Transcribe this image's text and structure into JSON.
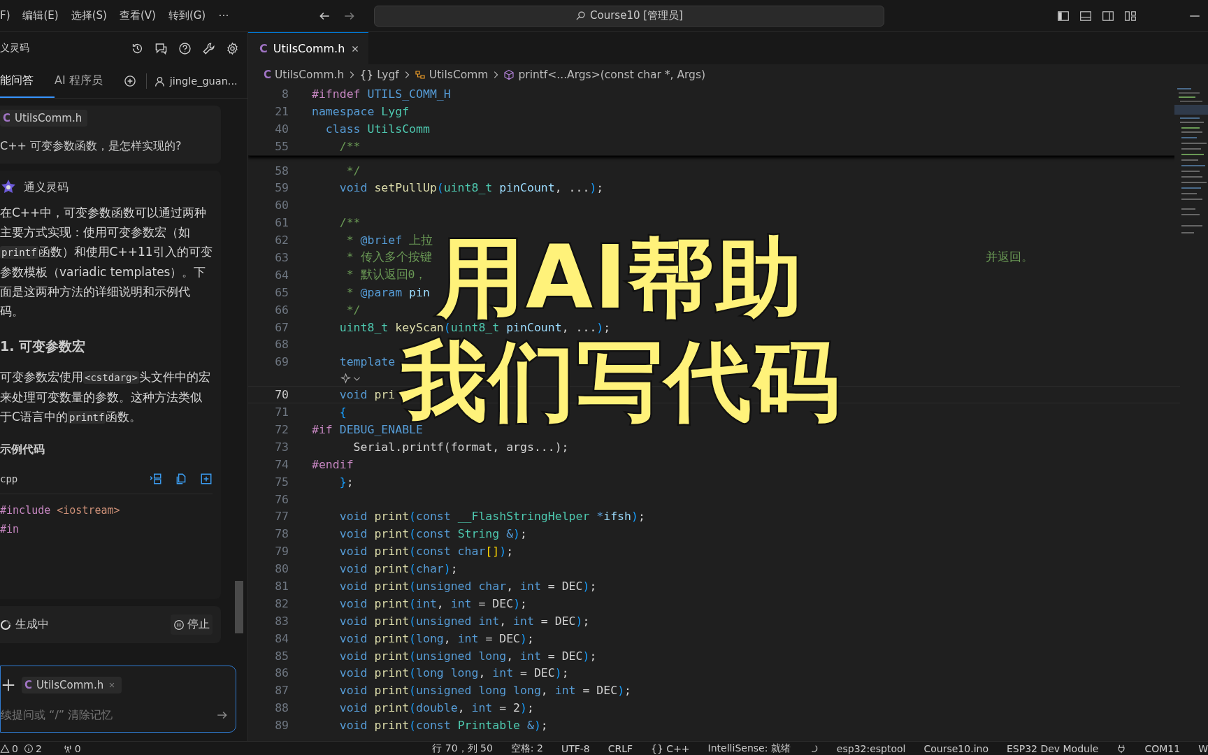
{
  "menu": [
    "F)",
    "编辑(E)",
    "选择(S)",
    "查看(V)",
    "转到(G)",
    "⋯"
  ],
  "command_center": "Course10 [管理员]",
  "assistant": {
    "title": "义灵码",
    "tabs": [
      {
        "label": "能问答",
        "selected": true
      },
      {
        "label": "AI 程序员",
        "selected": false
      }
    ],
    "user": "jingle_guan...",
    "context_file": {
      "glyph": "C",
      "name": "UtilsComm.h"
    },
    "question": "C++ 可变参数函数，是怎样实现的?",
    "answer_author": "通义灵码",
    "answer": [
      {
        "kind": "paragraph",
        "segments": [
          {
            "kind": "text",
            "text": "在C++中，可变参数函数可以通过两种主要方式实现：使用可变参数宏（如"
          },
          {
            "kind": "code",
            "text": "printf"
          },
          {
            "kind": "text",
            "text": "函数）和使用C++11引入的可变参数模板（variadic templates）。下面是这两种方法的详细说明和示例代码。"
          }
        ]
      },
      {
        "kind": "heading",
        "text": "1. 可变参数宏"
      },
      {
        "kind": "paragraph",
        "segments": [
          {
            "kind": "text",
            "text": "可变参数宏使用"
          },
          {
            "kind": "code",
            "text": "<cstdarg>"
          },
          {
            "kind": "text",
            "text": "头文件中的宏来处理可变数量的参数。这种方法类似于C语言中的"
          },
          {
            "kind": "code",
            "text": "printf"
          },
          {
            "kind": "text",
            "text": "函数。"
          }
        ]
      },
      {
        "kind": "subheading",
        "text": "示例代码"
      },
      {
        "kind": "codeblock",
        "lang": "cpp",
        "lines": [
          [
            {
              "text": "#include ",
              "kind": "macro"
            },
            {
              "text": "<iostream>",
              "kind": "str"
            }
          ],
          [
            {
              "text": "#in",
              "kind": "macro"
            }
          ]
        ]
      }
    ],
    "status": "生成中",
    "stop": "停止",
    "input": {
      "chip": {
        "glyph": "C",
        "name": "UtilsComm.h"
      },
      "placeholder": "续提问或 “/” 清除记忆"
    }
  },
  "editor": {
    "tabs": [
      {
        "glyph": "C",
        "label": "UtilsComm.h",
        "selected": true
      }
    ],
    "breadcrumb": [
      {
        "kind": "file",
        "glyph": "C",
        "label": "UtilsComm.h"
      },
      {
        "kind": "namespace",
        "glyph": "{}",
        "label": "Lygf"
      },
      {
        "kind": "class",
        "label": "UtilsComm"
      },
      {
        "kind": "method",
        "label": "printf<...Args>(const char *, Args)"
      }
    ],
    "sticky_lines": [
      {
        "n": "8",
        "tokens": [
          {
            "text": "#ifndef ",
            "kind": "macro"
          },
          {
            "text": "UTILS_COMM_H",
            "kind": "kw"
          }
        ]
      },
      {
        "n": "21",
        "tokens": [
          {
            "text": "namespace ",
            "kind": "kw"
          },
          {
            "text": "Lygf",
            "kind": "type"
          }
        ]
      },
      {
        "n": "40",
        "tokens": [
          {
            "text": "  class ",
            "kind": "kw"
          },
          {
            "text": "UtilsComm",
            "kind": "type"
          }
        ]
      },
      {
        "n": "55",
        "tokens": [
          {
            "text": "    /**",
            "kind": "cm"
          }
        ]
      }
    ],
    "lines": [
      {
        "kind": "code",
        "n": "58",
        "current": false,
        "tokens": [
          {
            "text": "     */",
            "kind": "cm"
          }
        ]
      },
      {
        "kind": "code",
        "n": "59",
        "current": false,
        "tokens": [
          {
            "text": "    void ",
            "kind": "kw"
          },
          {
            "text": "setPullUp",
            "kind": "fn"
          },
          {
            "text": "(",
            "kind": "br"
          },
          {
            "text": "uint8_t ",
            "kind": "type"
          },
          {
            "text": "pinCount",
            "kind": "var"
          },
          {
            "text": ", ...",
            "kind": "p"
          },
          {
            "text": ")",
            "kind": "br"
          },
          {
            "text": ";",
            "kind": "p"
          }
        ]
      },
      {
        "kind": "code",
        "n": "60",
        "current": false
      },
      {
        "kind": "code",
        "n": "61",
        "current": false,
        "tokens": [
          {
            "text": "    /**",
            "kind": "cm"
          }
        ]
      },
      {
        "kind": "code",
        "n": "62",
        "current": false,
        "tokens": [
          {
            "text": "     * ",
            "kind": "cm"
          },
          {
            "text": "@brief",
            "kind": "doc"
          },
          {
            "text": " 上拉",
            "kind": "cm"
          }
        ]
      },
      {
        "kind": "code",
        "n": "63",
        "current": false,
        "tokens": [
          {
            "text": "     * 传入多个按键",
            "kind": "cm"
          }
        ],
        "tail": [
          {
            "text": "并返回。",
            "kind": "cm"
          }
        ]
      },
      {
        "kind": "code",
        "n": "64",
        "current": false,
        "tokens": [
          {
            "text": "     * 默认返回0，",
            "kind": "cm"
          }
        ]
      },
      {
        "kind": "code",
        "n": "65",
        "current": false,
        "tokens": [
          {
            "text": "     * ",
            "kind": "cm"
          },
          {
            "text": "@param",
            "kind": "doc"
          },
          {
            "text": " pin",
            "kind": "var"
          }
        ]
      },
      {
        "kind": "code",
        "n": "66",
        "current": false,
        "tokens": [
          {
            "text": "     */",
            "kind": "cm"
          }
        ]
      },
      {
        "kind": "code",
        "n": "67",
        "current": false,
        "tokens": [
          {
            "text": "    uint8_t ",
            "kind": "type"
          },
          {
            "text": "keyScan",
            "kind": "fn"
          },
          {
            "text": "(",
            "kind": "br"
          },
          {
            "text": "uint8_t ",
            "kind": "type"
          },
          {
            "text": "pinCount",
            "kind": "var"
          },
          {
            "text": ", ...",
            "kind": "p"
          },
          {
            "text": ")",
            "kind": "br"
          },
          {
            "text": ";",
            "kind": "p"
          }
        ]
      },
      {
        "kind": "code",
        "n": "68",
        "current": false
      },
      {
        "kind": "code",
        "n": "69",
        "current": false,
        "tokens": [
          {
            "text": "    template",
            "kind": "kw"
          }
        ]
      },
      {
        "kind": "codelens"
      },
      {
        "kind": "code",
        "n": "70",
        "current": true,
        "tokens": [
          {
            "text": "    void ",
            "kind": "kw"
          },
          {
            "text": "pri",
            "kind": "fn"
          }
        ]
      },
      {
        "kind": "code",
        "n": "71",
        "current": false,
        "tokens": [
          {
            "text": "    {",
            "kind": "br"
          }
        ]
      },
      {
        "kind": "code",
        "n": "72",
        "current": false,
        "tokens": [
          {
            "text": "#if ",
            "kind": "macro"
          },
          {
            "text": "DEBUG_ENABLE",
            "kind": "kw"
          }
        ]
      },
      {
        "kind": "code",
        "n": "73",
        "current": false,
        "tokens": [
          {
            "text": "      Serial.printf(format, args...);",
            "kind": "p"
          }
        ]
      },
      {
        "kind": "code",
        "n": "74",
        "current": false,
        "tokens": [
          {
            "text": "#endif",
            "kind": "macro"
          }
        ]
      },
      {
        "kind": "code",
        "n": "75",
        "current": false,
        "tokens": [
          {
            "text": "    }",
            "kind": "br"
          },
          {
            "text": ";",
            "kind": "p"
          }
        ]
      },
      {
        "kind": "code",
        "n": "76",
        "current": false
      },
      {
        "kind": "code",
        "n": "77",
        "current": false,
        "tokens": [
          {
            "text": "    void ",
            "kind": "kw"
          },
          {
            "text": "print",
            "kind": "fn"
          },
          {
            "text": "(",
            "kind": "br"
          },
          {
            "text": "const ",
            "kind": "kw"
          },
          {
            "text": "__FlashStringHelper ",
            "kind": "type"
          },
          {
            "text": "*",
            "kind": "kw"
          },
          {
            "text": "ifsh",
            "kind": "var"
          },
          {
            "text": ")",
            "kind": "br"
          },
          {
            "text": ";",
            "kind": "p"
          }
        ]
      },
      {
        "kind": "code",
        "n": "78",
        "current": false,
        "tokens": [
          {
            "text": "    void ",
            "kind": "kw"
          },
          {
            "text": "print",
            "kind": "fn"
          },
          {
            "text": "(",
            "kind": "br"
          },
          {
            "text": "const ",
            "kind": "kw"
          },
          {
            "text": "String ",
            "kind": "type"
          },
          {
            "text": "&",
            "kind": "kw"
          },
          {
            "text": ")",
            "kind": "br"
          },
          {
            "text": ";",
            "kind": "p"
          }
        ]
      },
      {
        "kind": "code",
        "n": "79",
        "current": false,
        "tokens": [
          {
            "text": "    void ",
            "kind": "kw"
          },
          {
            "text": "print",
            "kind": "fn"
          },
          {
            "text": "(",
            "kind": "br"
          },
          {
            "text": "const char",
            "kind": "kw"
          },
          {
            "text": "[]",
            "kind": "y"
          },
          {
            "text": ")",
            "kind": "br"
          },
          {
            "text": ";",
            "kind": "p"
          }
        ]
      },
      {
        "kind": "code",
        "n": "80",
        "current": false,
        "tokens": [
          {
            "text": "    void ",
            "kind": "kw"
          },
          {
            "text": "print",
            "kind": "fn"
          },
          {
            "text": "(",
            "kind": "br"
          },
          {
            "text": "char",
            "kind": "kw"
          },
          {
            "text": ")",
            "kind": "br"
          },
          {
            "text": ";",
            "kind": "p"
          }
        ]
      },
      {
        "kind": "code",
        "n": "81",
        "current": false,
        "tokens": [
          {
            "text": "    void ",
            "kind": "kw"
          },
          {
            "text": "print",
            "kind": "fn"
          },
          {
            "text": "(",
            "kind": "br"
          },
          {
            "text": "unsigned char",
            "kind": "kw"
          },
          {
            "text": ", ",
            "kind": "p"
          },
          {
            "text": "int",
            "kind": "kw"
          },
          {
            "text": " = DEC",
            "kind": "p"
          },
          {
            "text": ")",
            "kind": "br"
          },
          {
            "text": ";",
            "kind": "p"
          }
        ]
      },
      {
        "kind": "code",
        "n": "82",
        "current": false,
        "tokens": [
          {
            "text": "    void ",
            "kind": "kw"
          },
          {
            "text": "print",
            "kind": "fn"
          },
          {
            "text": "(",
            "kind": "br"
          },
          {
            "text": "int",
            "kind": "kw"
          },
          {
            "text": ", ",
            "kind": "p"
          },
          {
            "text": "int",
            "kind": "kw"
          },
          {
            "text": " = DEC",
            "kind": "p"
          },
          {
            "text": ")",
            "kind": "br"
          },
          {
            "text": ";",
            "kind": "p"
          }
        ]
      },
      {
        "kind": "code",
        "n": "83",
        "current": false,
        "tokens": [
          {
            "text": "    void ",
            "kind": "kw"
          },
          {
            "text": "print",
            "kind": "fn"
          },
          {
            "text": "(",
            "kind": "br"
          },
          {
            "text": "unsigned int",
            "kind": "kw"
          },
          {
            "text": ", ",
            "kind": "p"
          },
          {
            "text": "int",
            "kind": "kw"
          },
          {
            "text": " = DEC",
            "kind": "p"
          },
          {
            "text": ")",
            "kind": "br"
          },
          {
            "text": ";",
            "kind": "p"
          }
        ]
      },
      {
        "kind": "code",
        "n": "84",
        "current": false,
        "tokens": [
          {
            "text": "    void ",
            "kind": "kw"
          },
          {
            "text": "print",
            "kind": "fn"
          },
          {
            "text": "(",
            "kind": "br"
          },
          {
            "text": "long",
            "kind": "kw"
          },
          {
            "text": ", ",
            "kind": "p"
          },
          {
            "text": "int",
            "kind": "kw"
          },
          {
            "text": " = DEC",
            "kind": "p"
          },
          {
            "text": ")",
            "kind": "br"
          },
          {
            "text": ";",
            "kind": "p"
          }
        ]
      },
      {
        "kind": "code",
        "n": "85",
        "current": false,
        "tokens": [
          {
            "text": "    void ",
            "kind": "kw"
          },
          {
            "text": "print",
            "kind": "fn"
          },
          {
            "text": "(",
            "kind": "br"
          },
          {
            "text": "unsigned long",
            "kind": "kw"
          },
          {
            "text": ", ",
            "kind": "p"
          },
          {
            "text": "int",
            "kind": "kw"
          },
          {
            "text": " = DEC",
            "kind": "p"
          },
          {
            "text": ")",
            "kind": "br"
          },
          {
            "text": ";",
            "kind": "p"
          }
        ]
      },
      {
        "kind": "code",
        "n": "86",
        "current": false,
        "tokens": [
          {
            "text": "    void ",
            "kind": "kw"
          },
          {
            "text": "print",
            "kind": "fn"
          },
          {
            "text": "(",
            "kind": "br"
          },
          {
            "text": "long long",
            "kind": "kw"
          },
          {
            "text": ", ",
            "kind": "p"
          },
          {
            "text": "int",
            "kind": "kw"
          },
          {
            "text": " = DEC",
            "kind": "p"
          },
          {
            "text": ")",
            "kind": "br"
          },
          {
            "text": ";",
            "kind": "p"
          }
        ]
      },
      {
        "kind": "code",
        "n": "87",
        "current": false,
        "tokens": [
          {
            "text": "    void ",
            "kind": "kw"
          },
          {
            "text": "print",
            "kind": "fn"
          },
          {
            "text": "(",
            "kind": "br"
          },
          {
            "text": "unsigned long long",
            "kind": "kw"
          },
          {
            "text": ", ",
            "kind": "p"
          },
          {
            "text": "int",
            "kind": "kw"
          },
          {
            "text": " = DEC",
            "kind": "p"
          },
          {
            "text": ")",
            "kind": "br"
          },
          {
            "text": ";",
            "kind": "p"
          }
        ]
      },
      {
        "kind": "code",
        "n": "88",
        "current": false,
        "tokens": [
          {
            "text": "    void ",
            "kind": "kw"
          },
          {
            "text": "print",
            "kind": "fn"
          },
          {
            "text": "(",
            "kind": "br"
          },
          {
            "text": "double",
            "kind": "kw"
          },
          {
            "text": ", ",
            "kind": "p"
          },
          {
            "text": "int",
            "kind": "kw"
          },
          {
            "text": " = 2",
            "kind": "p"
          },
          {
            "text": ")",
            "kind": "br"
          },
          {
            "text": ";",
            "kind": "p"
          }
        ]
      },
      {
        "kind": "code",
        "n": "89",
        "current": false,
        "tokens": [
          {
            "text": "    void ",
            "kind": "kw"
          },
          {
            "text": "print",
            "kind": "fn"
          },
          {
            "text": "(",
            "kind": "br"
          },
          {
            "text": "const ",
            "kind": "kw"
          },
          {
            "text": "Printable ",
            "kind": "type"
          },
          {
            "text": "&",
            "kind": "kw"
          },
          {
            "text": ")",
            "kind": "br"
          },
          {
            "text": ";",
            "kind": "p"
          }
        ]
      }
    ]
  },
  "caption": [
    "用AI帮助",
    "我们写代码"
  ],
  "status_bar": {
    "left": [
      {
        "kind": "warning",
        "text": "0"
      },
      {
        "kind": "info",
        "text": "2"
      },
      {
        "kind": "broadcast",
        "text": "0"
      }
    ],
    "right": [
      {
        "kind": "text",
        "text": "行 70，列 50"
      },
      {
        "kind": "text",
        "text": "空格: 2"
      },
      {
        "kind": "text",
        "text": "UTF-8"
      },
      {
        "kind": "text",
        "text": "CRLF"
      },
      {
        "kind": "text",
        "text": "{} C++"
      },
      {
        "kind": "text",
        "text": "IntelliSense: 就绪"
      },
      {
        "kind": "sync"
      },
      {
        "kind": "text",
        "text": "esp32:esptool"
      },
      {
        "kind": "text",
        "text": "Course10.ino"
      },
      {
        "kind": "text",
        "text": "ESP32 Dev Module"
      },
      {
        "kind": "plug"
      },
      {
        "kind": "text",
        "text": "COM11"
      },
      {
        "kind": "text",
        "text": "W"
      }
    ]
  }
}
